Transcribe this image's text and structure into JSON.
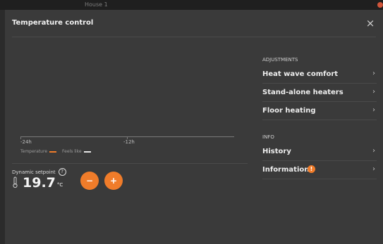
{
  "background": {
    "tab_title": "House 1"
  },
  "modal": {
    "title": "Temperature control",
    "close_glyph": "×"
  },
  "chart_data": {
    "type": "line",
    "x_ticks": [
      "-24h",
      "-12h"
    ],
    "series": [
      {
        "name": "Temperature",
        "color": "#f07c2a",
        "values": []
      },
      {
        "name": "Feels like",
        "color": "#e6e6e6",
        "values": []
      }
    ]
  },
  "setpoint": {
    "label": "Dynamic setpoint",
    "help_glyph": "?",
    "value": "19.7",
    "unit": "°C",
    "decrease_glyph": "−",
    "increase_glyph": "+"
  },
  "adjustments": {
    "header": "ADJUSTMENTS",
    "items": [
      {
        "label": "Heat wave comfort"
      },
      {
        "label": "Stand-alone heaters"
      },
      {
        "label": "Floor heating"
      }
    ]
  },
  "info": {
    "header": "INFO",
    "items": [
      {
        "label": "History"
      },
      {
        "label": "Information",
        "badge": "!"
      }
    ]
  },
  "chevron_glyph": "›",
  "accent_color": "#f07c2a"
}
